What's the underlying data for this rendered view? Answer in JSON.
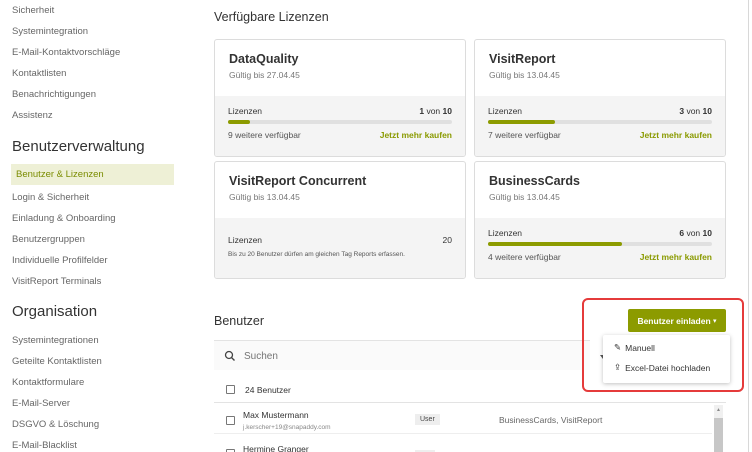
{
  "sidebar": {
    "top_items": [
      "Sicherheit",
      "Systemintegration",
      "E-Mail-Kontaktvorschläge",
      "Kontaktlisten",
      "Benachrichtigungen",
      "Assistenz"
    ],
    "section1": "Benutzerverwaltung",
    "section1_items": [
      "Benutzer & Lizenzen",
      "Login & Sicherheit",
      "Einladung & Onboarding",
      "Benutzergruppen",
      "Individuelle Profilfelder",
      "VisitReport Terminals"
    ],
    "section2": "Organisation",
    "section2_items": [
      "Systemintegrationen",
      "Geteilte Kontaktlisten",
      "Kontaktformulare",
      "E-Mail-Server",
      "DSGVO & Löschung",
      "E-Mail-Blacklist"
    ]
  },
  "licenses": {
    "title": "Verfügbare Lizenzen",
    "cards": [
      {
        "name": "DataQuality",
        "valid": "Gültig bis 27.04.45",
        "label": "Lizenzen",
        "used": "1",
        "of": "von",
        "total": "10",
        "fill": 0.1,
        "available": "9 weitere verfügbar",
        "buy": "Jetzt mehr kaufen"
      },
      {
        "name": "VisitReport",
        "valid": "Gültig bis 13.04.45",
        "label": "Lizenzen",
        "used": "3",
        "of": "von",
        "total": "10",
        "fill": 0.3,
        "available": "7 weitere verfügbar",
        "buy": "Jetzt mehr kaufen"
      },
      {
        "name": "VisitReport Concurrent",
        "valid": "Gültig bis 13.04.45",
        "label": "Lizenzen",
        "count": "20",
        "note": "Bis zu 20 Benutzer dürfen am gleichen Tag Reports erfassen."
      },
      {
        "name": "BusinessCards",
        "valid": "Gültig bis 13.04.45",
        "label": "Lizenzen",
        "used": "6",
        "of": "von",
        "total": "10",
        "fill": 0.6,
        "available": "4 weitere verfügbar",
        "buy": "Jetzt mehr kaufen"
      }
    ]
  },
  "users": {
    "title": "Benutzer",
    "invite_button": "Benutzer einladen",
    "invite_caret": "▾",
    "dropdown": [
      {
        "icon": "✎",
        "label": "Manuell"
      },
      {
        "icon": "⇪",
        "label": "Excel-Datei hochladen"
      }
    ],
    "search_placeholder": "Suchen",
    "count_label": "24 Benutzer",
    "rows": [
      {
        "name": "Max Mustermann",
        "email": "j.kerscher+19@snapaddy.com",
        "role": "User",
        "licenses": "BusinessCards, VisitReport"
      },
      {
        "name": "Hermine Granger",
        "email": "",
        "role": "",
        "licenses": ""
      }
    ]
  },
  "colors": {
    "accent": "#8c9b00",
    "highlight": "#e53b3b"
  }
}
